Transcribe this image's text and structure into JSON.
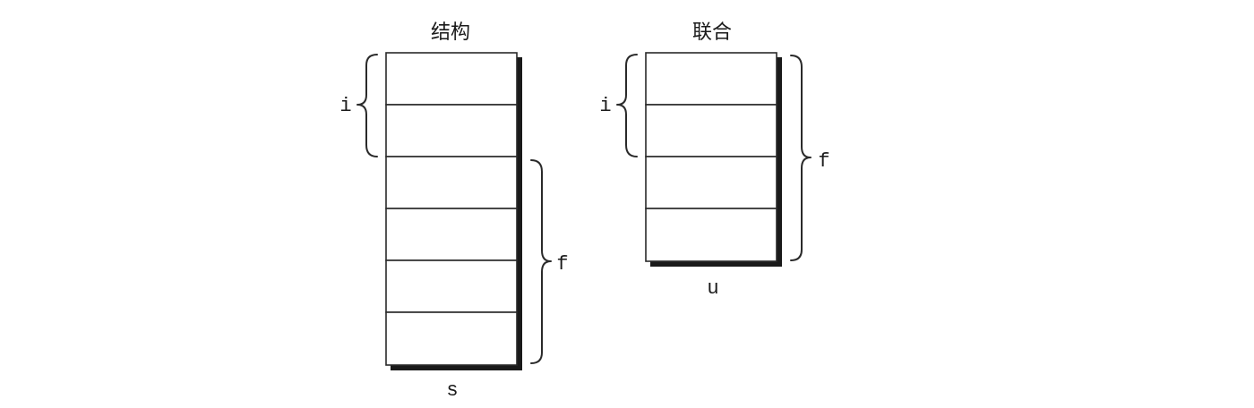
{
  "struct": {
    "title": "结构",
    "variable": "s",
    "members": [
      {
        "label": "i",
        "cells": 2
      },
      {
        "label": "f",
        "cells": 4
      }
    ]
  },
  "union": {
    "title": "联合",
    "variable": "u",
    "members": [
      {
        "label": "i",
        "cells": 2
      },
      {
        "label": "f",
        "cells": 4
      }
    ]
  }
}
